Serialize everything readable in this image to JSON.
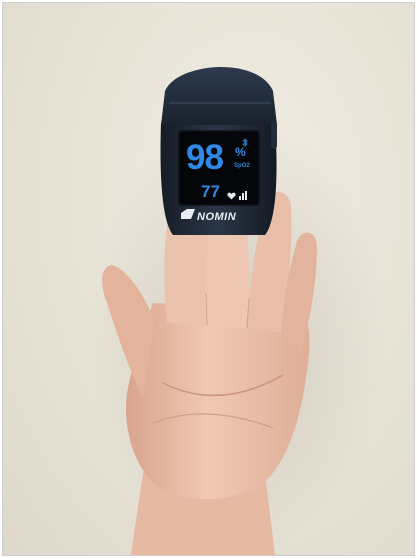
{
  "oximeter": {
    "spo2_value": "98",
    "spo2_unit": "%",
    "spo2_label": "SpO2",
    "pulse_value": "77",
    "brand_text": "NOMIN"
  },
  "colors": {
    "wall": "#e9e4d8",
    "device_body": "#1f2a38",
    "screen": "#050607",
    "display_blue": "#2e8ae6",
    "skin": "#e8bfa8"
  },
  "icons": {
    "bluetooth": "bluetooth-icon",
    "heart": "heart-icon",
    "signal": "signal-bars-icon",
    "brand_logo": "nomin-logo-icon"
  }
}
